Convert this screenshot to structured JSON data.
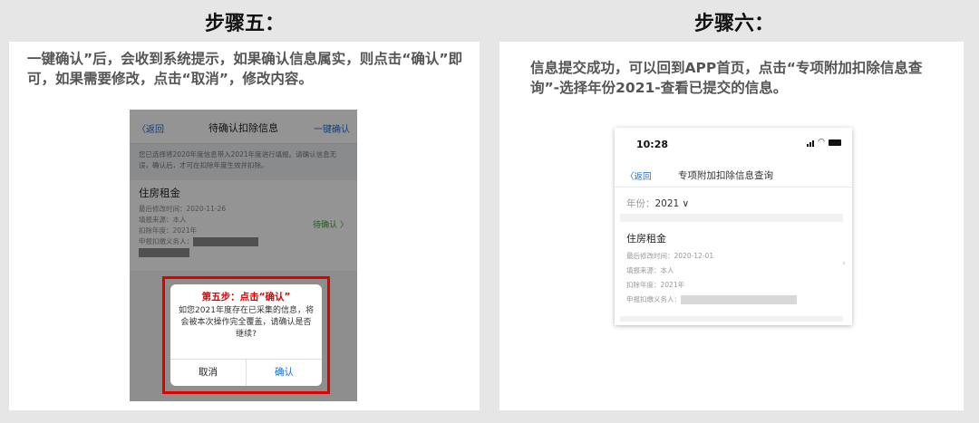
{
  "step5": {
    "title": "步骤五：",
    "description": "一键确认”后，会收到系统提示，如果确认信息属实，则点击“确认”即可，如果需要修改，点击“取消”，修改内容。",
    "screen": {
      "back_label": "〈返回",
      "nav_title": "待确认扣除信息",
      "one_click_label": "一键确认",
      "notice": "您已选择将2020年度信息带入2021年度进行填报。请确认信息无误，确认后，才可在扣除年度生效并扣除。",
      "card": {
        "title": "住房租金",
        "modified": "最后修改时间：2020-11-26",
        "source": "填报来源：本人",
        "year": "扣除年度：2021年",
        "withholder": "申报扣缴义务人：",
        "status": "待确认 〉"
      },
      "dialog": {
        "step_label": "第五步：点击“确认”",
        "message": "如您2021年度存在已采集的信息，将会被本次操作完全覆盖，请确认是否继续?",
        "cancel": "取消",
        "confirm": "确认"
      }
    }
  },
  "step6": {
    "title": "步骤六：",
    "description": "信息提交成功，可以回到APP首页，点击“专项附加扣除信息查询”-选择年份2021-查看已提交的信息。",
    "screen": {
      "time": "10:28",
      "back_label": "〈返回",
      "nav_title": "专项附加扣除信息查询",
      "year_label": "年份：",
      "year_value": "2021 ∨",
      "card": {
        "title": "住房租金",
        "modified": "最后修改时间：2020-12-01",
        "source": "填报来源：本人",
        "year": "扣除年度：2021年",
        "withholder": "申报扣缴义务人："
      },
      "chevron": "›"
    }
  },
  "colors": {
    "accent_blue": "#1a6cd6",
    "highlight_red": "#e00000",
    "status_green": "#3a9a3a"
  }
}
